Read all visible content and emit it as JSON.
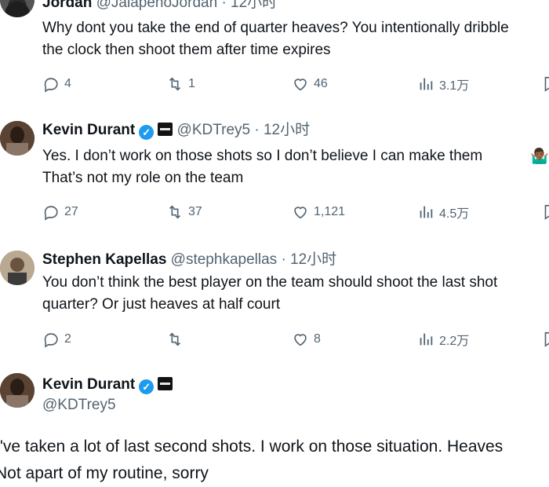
{
  "tweets": [
    {
      "name": "Jordan",
      "handle": "@JalapenoJordan",
      "sep": "·",
      "time": "12小时",
      "text": "Why dont you take the end of quarter heaves? You intentionally dribble\nthe clock then shoot them after time expires",
      "replies": "4",
      "retweets": "1",
      "likes": "46",
      "views": "3.1万"
    },
    {
      "name": "Kevin Durant",
      "handle": "@KDTrey5",
      "sep": "·",
      "time": "12小时",
      "text": "Yes. I don’t work on those shots so I don’t believe I can make them \nThat’s not my role on the team",
      "emoji": "🤷🏾‍♂️",
      "replies": "27",
      "retweets": "37",
      "likes": "1,121",
      "views": "4.5万"
    },
    {
      "name": "Stephen Kapellas",
      "handle": "@stephkapellas",
      "sep": "·",
      "time": "12小时",
      "text": "You don’t think the best player on the team should shoot the last shot\nquarter? Or just heaves at half court",
      "replies": "2",
      "retweets": "",
      "likes": "8",
      "views": "2.2万"
    }
  ],
  "main_tweet": {
    "name": "Kevin Durant",
    "handle": "@KDTrey5",
    "text": "I've taken a lot of last second shots. I work on those situation. Heaves\nNot apart of my routine, sorry"
  },
  "icons": {
    "reply": "reply-icon",
    "retweet": "retweet-icon",
    "like": "heart-icon",
    "views": "views-icon",
    "bookmark": "bookmark-icon",
    "verified": "verified-badge-icon",
    "affiliate": "affiliate-badge-icon"
  },
  "colors": {
    "verified": "#1d9bf0",
    "secondary_text": "#536471"
  }
}
